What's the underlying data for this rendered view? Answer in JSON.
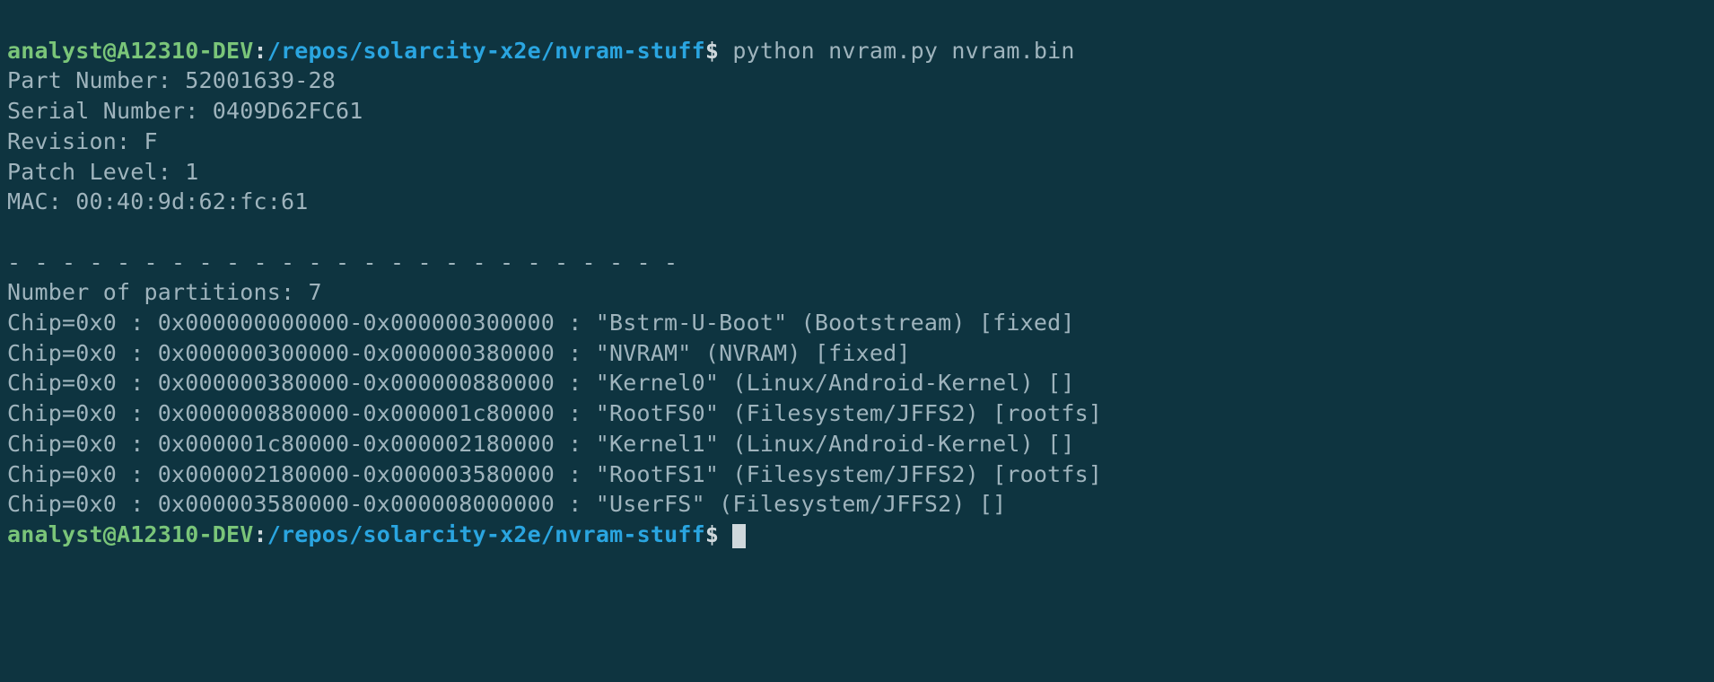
{
  "prompt": {
    "user_host": "analyst@A12310-DEV",
    "colon": ":",
    "path": "/repos/solarcity-x2e/nvram-stuff",
    "dollar": "$ "
  },
  "command": "python nvram.py nvram.bin",
  "device_info": {
    "part_number_label": "Part Number: ",
    "part_number": "52001639-28",
    "serial_number_label": "Serial Number: ",
    "serial_number": "0409D62FC61",
    "revision_label": "Revision: ",
    "revision": "F",
    "patch_level_label": "Patch Level: ",
    "patch_level": "1",
    "mac_label": "MAC: ",
    "mac": "00:40:9d:62:fc:61"
  },
  "separator": "- - - - - - - - - - - - - - - - - - - - - - - - -",
  "partitions_header": "Number of partitions: 7",
  "partitions": [
    "Chip=0x0 : 0x000000000000-0x000000300000 : \"Bstrm-U-Boot\" (Bootstream) [fixed]",
    "Chip=0x0 : 0x000000300000-0x000000380000 : \"NVRAM\" (NVRAM) [fixed]",
    "Chip=0x0 : 0x000000380000-0x000000880000 : \"Kernel0\" (Linux/Android-Kernel) []",
    "Chip=0x0 : 0x000000880000-0x000001c80000 : \"RootFS0\" (Filesystem/JFFS2) [rootfs]",
    "Chip=0x0 : 0x000001c80000-0x000002180000 : \"Kernel1\" (Linux/Android-Kernel) []",
    "Chip=0x0 : 0x000002180000-0x000003580000 : \"RootFS1\" (Filesystem/JFFS2) [rootfs]",
    "Chip=0x0 : 0x000003580000-0x000008000000 : \"UserFS\" (Filesystem/JFFS2) []"
  ],
  "blank": ""
}
